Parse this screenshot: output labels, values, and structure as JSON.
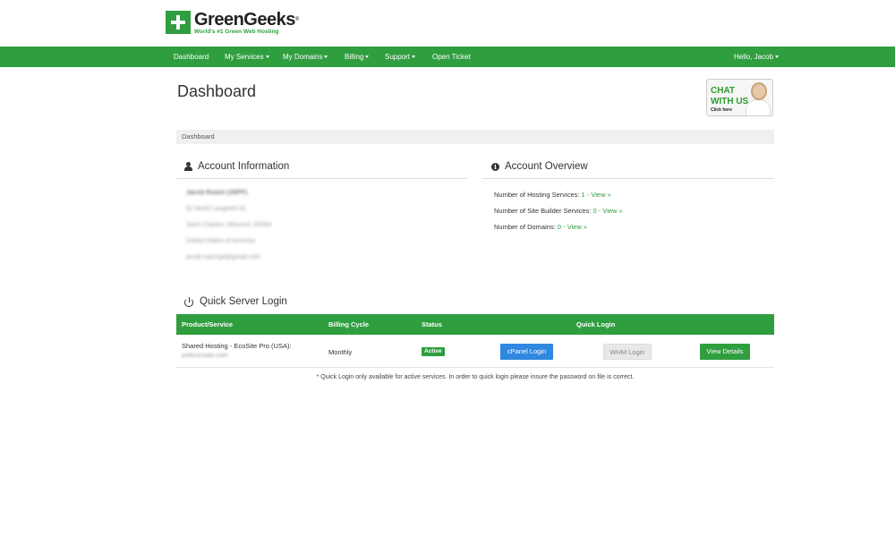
{
  "brand": {
    "name": "GreenGeeks",
    "registered": "®",
    "tagline": "World's #1 Green Web Hosting",
    "accent_color": "#2f9e3f"
  },
  "nav": {
    "items": [
      {
        "label": "Dashboard",
        "dropdown": false
      },
      {
        "label": "My Services",
        "dropdown": true
      },
      {
        "label": "My Domains",
        "dropdown": true
      },
      {
        "label": "Billing",
        "dropdown": true
      },
      {
        "label": "Support",
        "dropdown": true
      },
      {
        "label": "Open Ticket",
        "dropdown": false
      }
    ],
    "user_greeting": "Hello,  Jacob"
  },
  "page": {
    "title": "Dashboard",
    "breadcrumb": "Dashboard"
  },
  "chat": {
    "line1": "CHAT",
    "line2": "WITH US",
    "line3": "Click here"
  },
  "account_info": {
    "heading": "Account Information",
    "lines": [
      "Jacob Roach (1BPF)",
      "81 North Langfield St.",
      "Saint Charles, Missouri, 63304",
      "United States of America",
      "jacob.roachgd@gmail.com"
    ]
  },
  "account_overview": {
    "heading": "Account Overview",
    "rows": [
      {
        "label": "Number of Hosting Services:",
        "count": "1",
        "sep": " - ",
        "link": "View »"
      },
      {
        "label": "Number of Site Builder Services:",
        "count": "0",
        "sep": " - ",
        "link": "View »"
      },
      {
        "label": "Number of Domains:",
        "count": "0",
        "sep": " - ",
        "link": "View »"
      }
    ]
  },
  "quick_login": {
    "heading": "Quick Server Login",
    "columns": [
      "Product/Service",
      "Billing Cycle",
      "Status",
      "Quick Login"
    ],
    "rows": [
      {
        "product": "Shared Hosting - EcoSite Pro (USA):",
        "domain": "jiraficonsalo.com",
        "billing_cycle": "Monthly",
        "status": "Active",
        "cpanel_label": "cPanel Login",
        "whm_label": "WHM Login",
        "details_label": "View Details"
      }
    ],
    "footnote": "* Quick Login only available for active services. In order to quick login please insure the password on file is correct."
  }
}
